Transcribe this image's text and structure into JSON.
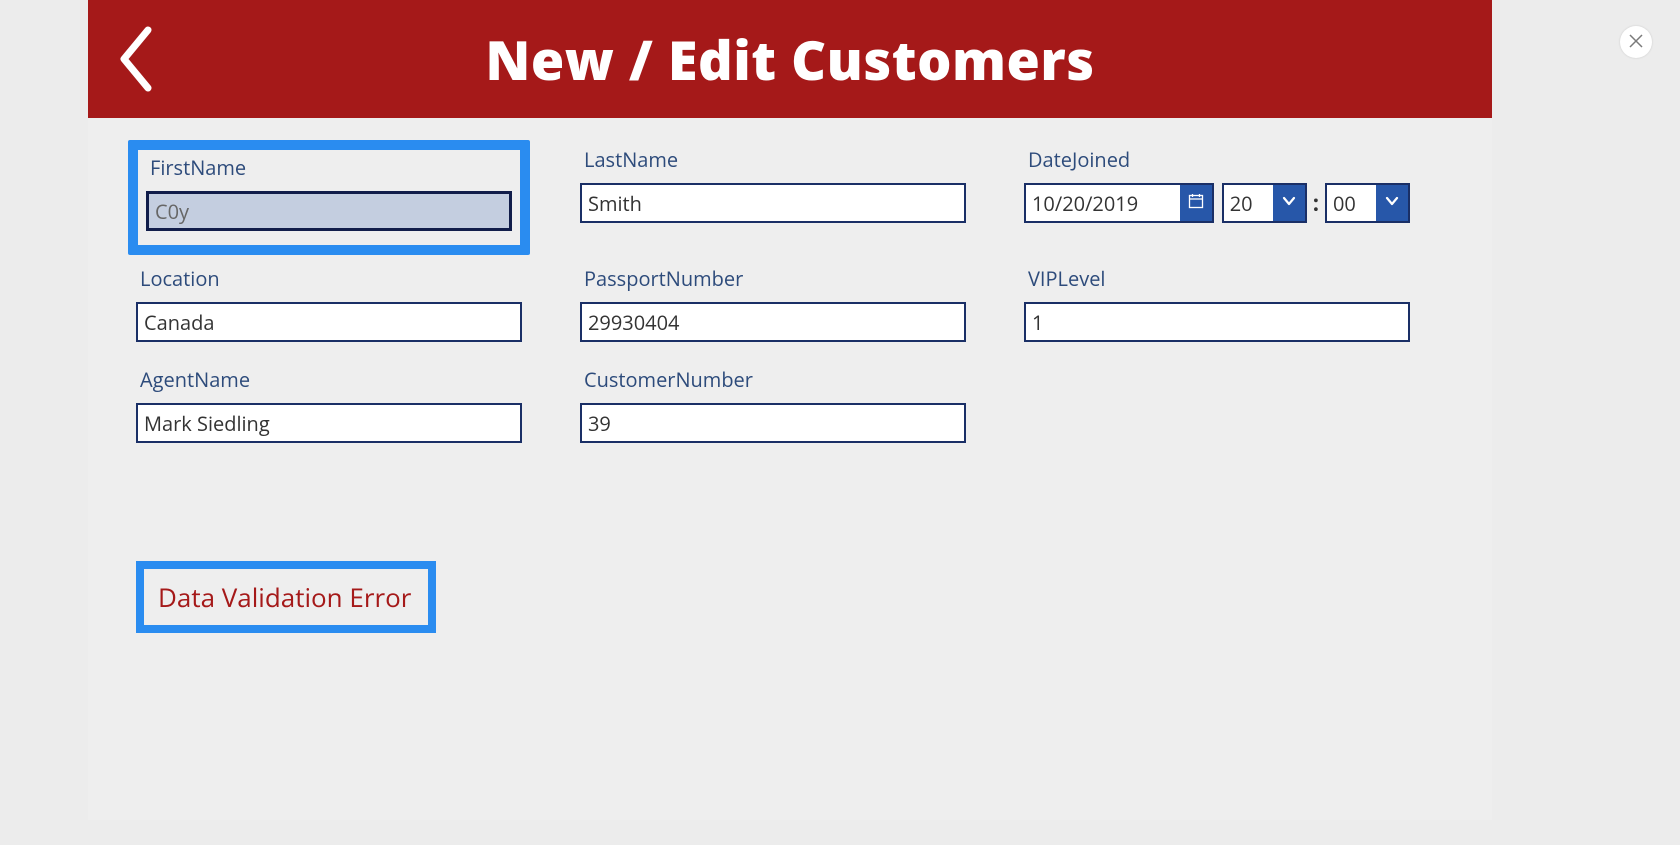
{
  "header": {
    "title": "New / Edit Customers"
  },
  "fields": {
    "firstName": {
      "label": "FirstName",
      "value": "C0y"
    },
    "lastName": {
      "label": "LastName",
      "value": "Smith"
    },
    "dateJoined": {
      "label": "DateJoined",
      "date": "10/20/2019",
      "hour": "20",
      "minute": "00",
      "separator": ":"
    },
    "location": {
      "label": "Location",
      "value": "Canada"
    },
    "passportNumber": {
      "label": "PassportNumber",
      "value": "29930404"
    },
    "vipLevel": {
      "label": "VIPLevel",
      "value": "1"
    },
    "agentName": {
      "label": "AgentName",
      "value": "Mark Siedling"
    },
    "customerNumber": {
      "label": "CustomerNumber",
      "value": "39"
    }
  },
  "error": "Data Validation Error"
}
